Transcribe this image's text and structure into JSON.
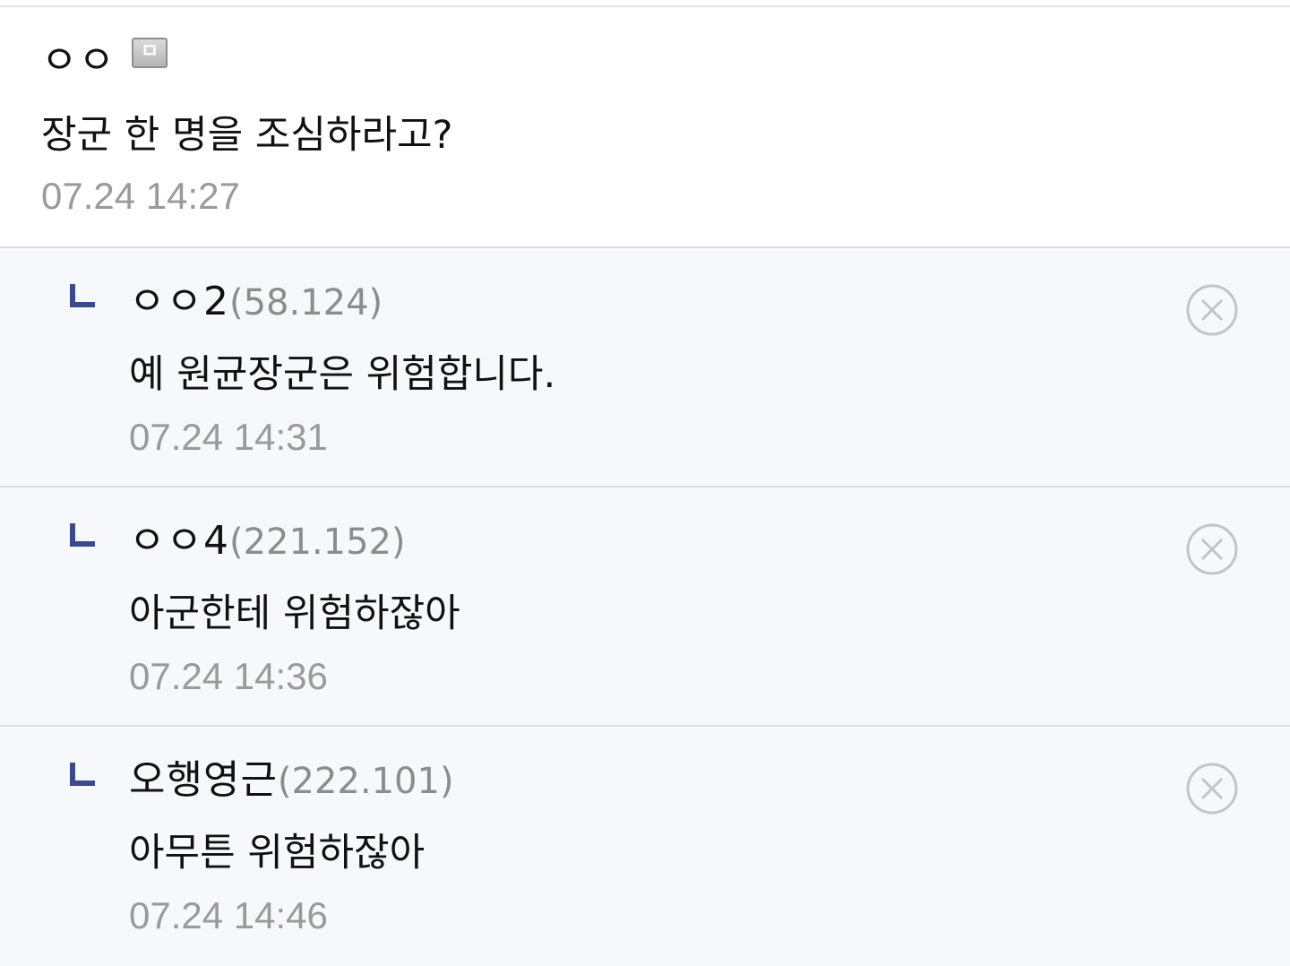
{
  "comments": [
    {
      "nick": "ㅇㅇ",
      "badge_icon": "fixed-nick-badge-icon",
      "text": "장군 한 명을 조심하라고?",
      "time": "07.24 14:27"
    }
  ],
  "replies": [
    {
      "nick": "ㅇㅇ2",
      "ip": "(58.124)",
      "text": "예 원균장군은 위험합니다.",
      "time": "07.24 14:31"
    },
    {
      "nick": "ㅇㅇ4",
      "ip": "(221.152)",
      "text": "아군한테 위험하잖아",
      "time": "07.24 14:36"
    },
    {
      "nick": "오행영근",
      "ip": "(222.101)",
      "text": "아무튼 위험하잖아",
      "time": "07.24 14:46"
    }
  ],
  "icons": {
    "reply_arrow": "reply-arrow-icon",
    "delete": "delete-circle-x-icon"
  },
  "colors": {
    "reply_arrow": "#3b4a8c",
    "reply_background": "#f7f8fb",
    "timestamp": "#9a9a9a",
    "ip": "#8c8c8c"
  }
}
